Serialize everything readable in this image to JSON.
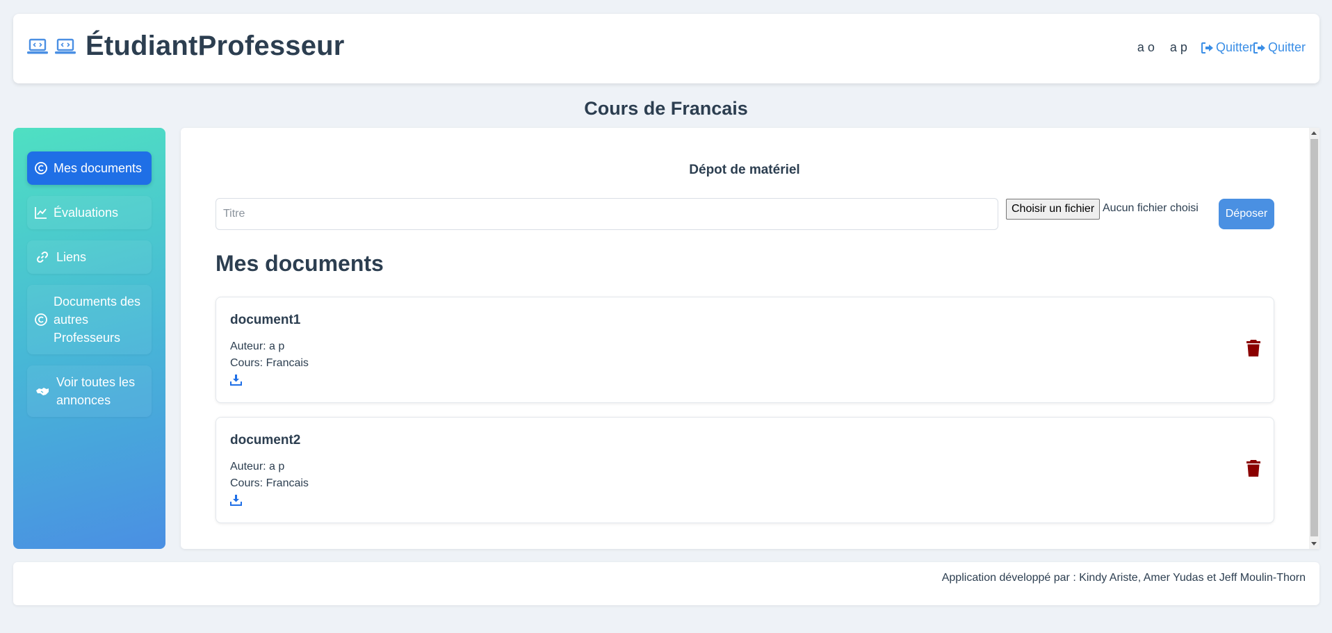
{
  "header": {
    "brand_icons": [
      "laptop-code-icon",
      "laptop-code-icon"
    ],
    "title": "ÉtudiantProfesseur",
    "users": [
      "a o",
      "a p"
    ],
    "quit_label_1": "Quitter",
    "quit_label_2": "Quitter"
  },
  "page": {
    "title": "Cours de Francais"
  },
  "sidebar": {
    "items": [
      {
        "label": "Mes documents",
        "icon": "copyright-icon",
        "active": true
      },
      {
        "label": "Évaluations",
        "icon": "chart-line-icon",
        "active": false
      },
      {
        "label": "Liens",
        "icon": "link-icon",
        "active": false
      },
      {
        "label": "Documents des autres Professeurs",
        "icon": "copyright-icon",
        "active": false
      },
      {
        "label": "Voir toutes les annonces",
        "icon": "handshake-icon",
        "active": false
      }
    ]
  },
  "upload": {
    "heading": "Dépot de matériel",
    "title_placeholder": "Titre",
    "file_button": "Choisir un fichier",
    "file_status": "Aucun fichier choisi",
    "submit": "Déposer"
  },
  "documents": {
    "heading": "Mes documents",
    "items": [
      {
        "name": "document1",
        "author": "Auteur: a p",
        "course": "Cours: Francais"
      },
      {
        "name": "document2",
        "author": "Auteur: a p",
        "course": "Cours: Francais"
      }
    ]
  },
  "footer": {
    "text": "Application développé par : Kindy Ariste, Amer Yudas et Jeff Moulin-Thorn"
  },
  "colors": {
    "accent": "#4a90e2",
    "active_nav": "#1f6fe6",
    "delete": "#8b0000",
    "link": "#3a8ee6"
  }
}
